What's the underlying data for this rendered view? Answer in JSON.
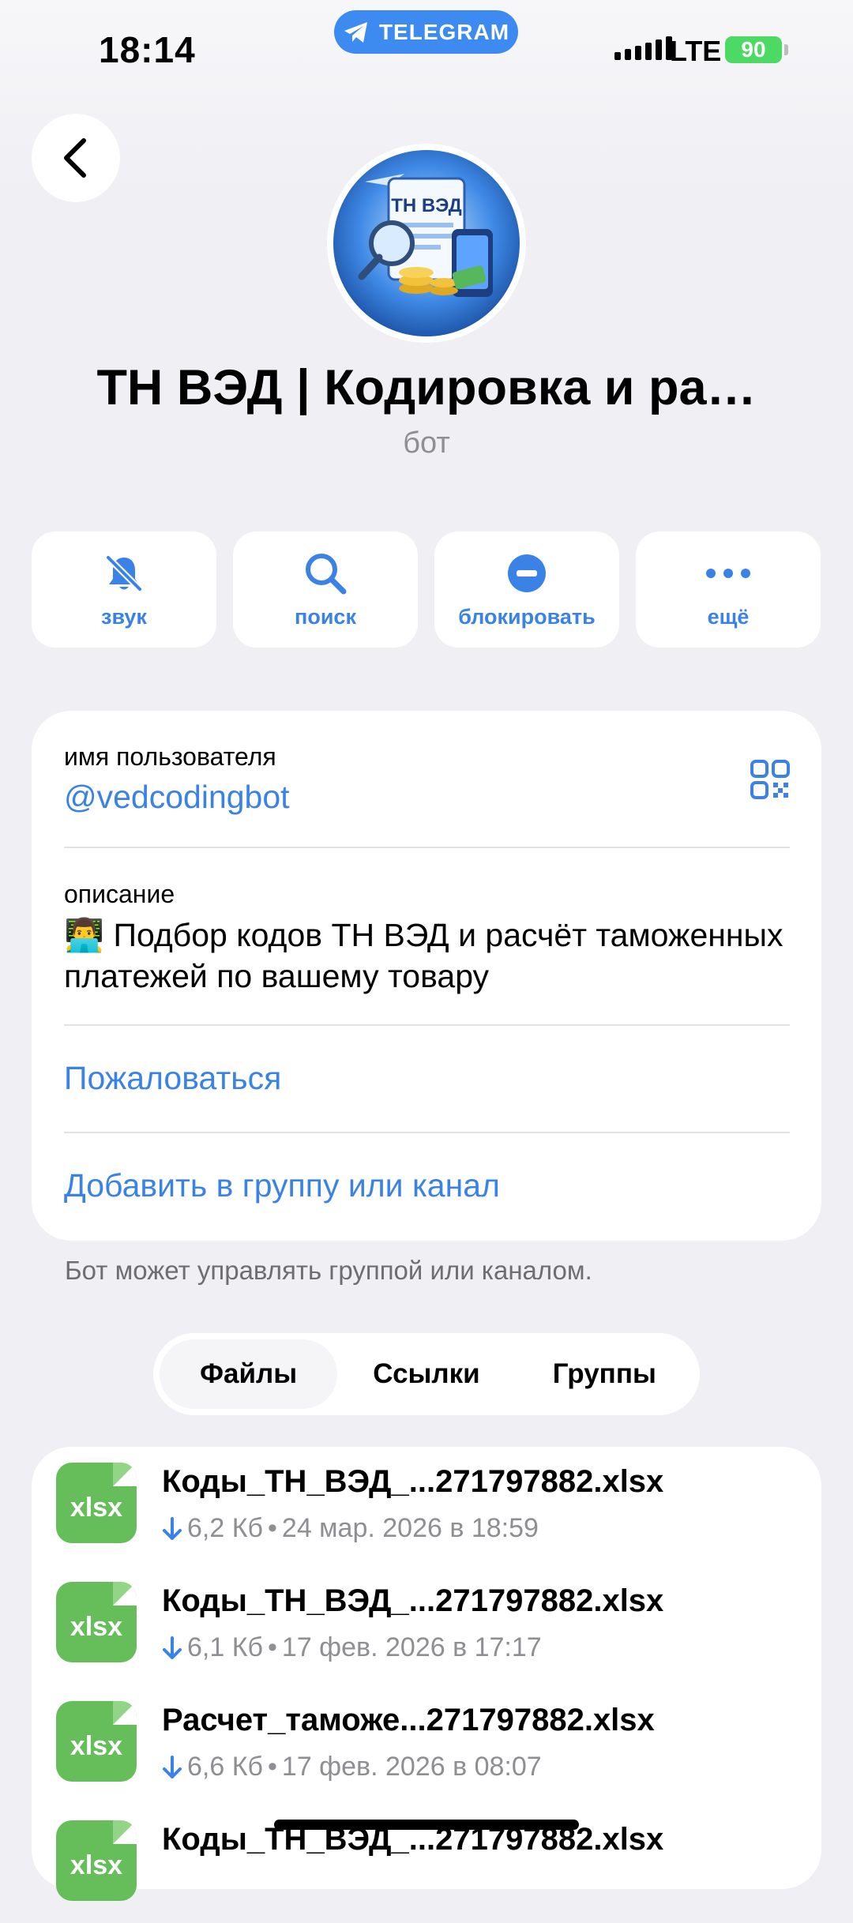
{
  "status_bar": {
    "time": "18:14",
    "app_pill": "TELEGRAM",
    "network": "LTE",
    "battery": "90"
  },
  "profile": {
    "title": "ТН ВЭД | Кодировка и ра…",
    "subtitle": "бот",
    "avatar_text": "ТН ВЭД"
  },
  "actions": [
    {
      "label": "звук",
      "icon": "bell-slash-icon"
    },
    {
      "label": "поиск",
      "icon": "search-icon"
    },
    {
      "label": "блокировать",
      "icon": "block-icon"
    },
    {
      "label": "ещё",
      "icon": "more-icon"
    }
  ],
  "info": {
    "username_label": "имя пользователя",
    "username": "@vedcodingbot",
    "description_label": "описание",
    "description_emoji": "👨‍💻",
    "description": "Подбор кодов ТН ВЭД и расчёт таможенных платежей по вашему товару",
    "report": "Пожаловаться",
    "add_to_group": "Добавить в группу или канал"
  },
  "hint": "Бот может управлять группой или каналом.",
  "tabs": [
    {
      "label": "Файлы",
      "active": true
    },
    {
      "label": "Ссылки",
      "active": false
    },
    {
      "label": "Группы",
      "active": false
    }
  ],
  "files": [
    {
      "ext": "xlsx",
      "name": "Коды_ТН_ВЭД_...271797882.xlsx",
      "size": "6,2 Кб",
      "date": "24 мар. 2026 в 18:59"
    },
    {
      "ext": "xlsx",
      "name": "Коды_ТН_ВЭД_...271797882.xlsx",
      "size": "6,1 Кб",
      "date": "17 фев. 2026 в 17:17"
    },
    {
      "ext": "xlsx",
      "name": "Расчет_таможе...271797882.xlsx",
      "size": "6,6 Кб",
      "date": "17 фев. 2026 в 08:07"
    },
    {
      "ext": "xlsx",
      "name": "Коды_ТН_ВЭД_...271797882.xlsx",
      "size": "",
      "date": ""
    }
  ],
  "colors": {
    "accent": "#3b82e6",
    "file_green": "#66be5a",
    "background": "#efeff4"
  }
}
